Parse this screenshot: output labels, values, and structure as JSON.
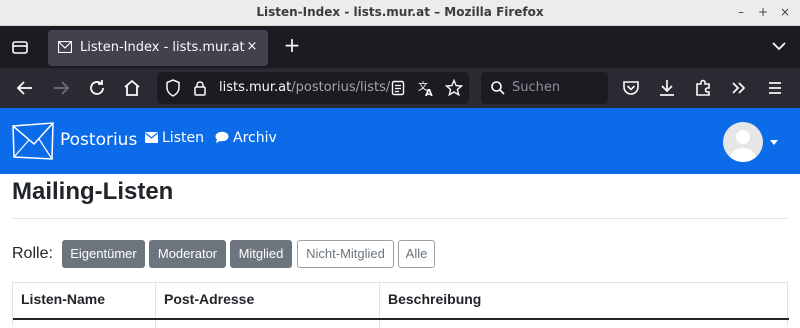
{
  "window": {
    "title": "Listen-Index - lists.mur.at – Mozilla Firefox",
    "controls": {
      "minimize": "–",
      "maximize": "+",
      "close": "×"
    }
  },
  "tab": {
    "label": "Listen-Index - lists.mur.at",
    "close": "×"
  },
  "new_tab": "+",
  "address_bar": {
    "host": "lists.mur.at",
    "path": "/postorius/lists/"
  },
  "search": {
    "placeholder": "Suchen"
  },
  "site": {
    "brand": "Postorius",
    "nav": {
      "lists": "Listen",
      "archive": "Archiv"
    }
  },
  "page": {
    "title": "Mailing-Listen",
    "role_label": "Rolle:",
    "roles": [
      {
        "label": "Eigentümer",
        "active": true
      },
      {
        "label": "Moderator",
        "active": true
      },
      {
        "label": "Mitglied",
        "active": true
      },
      {
        "label": "Nicht-Mitglied",
        "active": false
      },
      {
        "label": "Alle",
        "active": false
      }
    ]
  },
  "table": {
    "columns": [
      "Listen-Name",
      "Post-Adresse",
      "Beschreibung"
    ]
  },
  "colors": {
    "header_blue": "#0c6be8",
    "tab_bg": "#42414d",
    "toolbar_bg": "#2b2a33",
    "button_gray": "#6c757d"
  }
}
